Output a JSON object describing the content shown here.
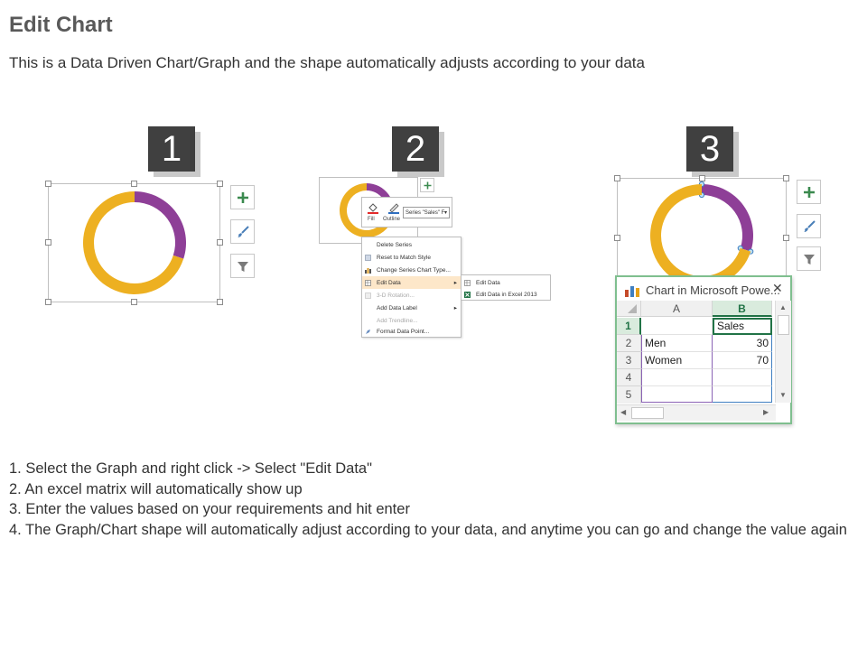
{
  "header": {
    "title": "Edit Chart",
    "subtitle": "This is a Data Driven Chart/Graph and the shape automatically adjusts according to your data"
  },
  "steps_badges": [
    "1",
    "2",
    "3"
  ],
  "colors": {
    "gold": "#EDB021",
    "purple": "#8E3F97",
    "badge": "#404040",
    "excel_green": "#4E9A5E"
  },
  "panel1": {
    "icons": [
      "plus-icon",
      "brush-icon",
      "filter-icon"
    ]
  },
  "panel2": {
    "mini_toolbar": {
      "fill_label": "Fill",
      "outline_label": "Outline",
      "series_dropdown": "Series \"Sales\" F"
    },
    "context_menu": [
      {
        "label": "Delete Series",
        "disabled": false
      },
      {
        "label": "Reset to Match Style",
        "disabled": false
      },
      {
        "label": "Change Series Chart Type...",
        "disabled": false
      },
      {
        "label": "Edit Data",
        "disabled": false,
        "highlighted": true,
        "arrow": "▸"
      },
      {
        "label": "3-D Rotation...",
        "disabled": true
      },
      {
        "label": "Add Data Label",
        "disabled": false,
        "arrow": "▸"
      },
      {
        "label": "Add Trendline...",
        "disabled": true
      },
      {
        "label": "Format Data Point...",
        "disabled": false
      }
    ],
    "submenu": [
      "Edit Data",
      "Edit Data in Excel 2013"
    ]
  },
  "panel3": {
    "excel": {
      "window_title": "Chart in Microsoft Powe...",
      "close_label": "✕",
      "col_headers": [
        "A",
        "B"
      ],
      "row_numbers": [
        "1",
        "2",
        "3",
        "4",
        "5"
      ],
      "header_cell": "Sales",
      "rows": [
        {
          "label": "Men",
          "value": "30"
        },
        {
          "label": "Women",
          "value": "70"
        }
      ]
    }
  },
  "chart_data": {
    "type": "pie",
    "categories": [
      "Men",
      "Women"
    ],
    "series": [
      {
        "name": "Sales",
        "values": [
          30,
          70
        ]
      }
    ],
    "colors": [
      "#8E3F97",
      "#EDB021"
    ]
  },
  "instructions": [
    "1. Select the Graph and right click -> Select \"Edit Data\"",
    "2. An excel matrix will automatically show up",
    "3. Enter the values based on your requirements and hit enter",
    "4. The Graph/Chart shape will automatically adjust according to your data, and anytime you can go and change the value again"
  ]
}
